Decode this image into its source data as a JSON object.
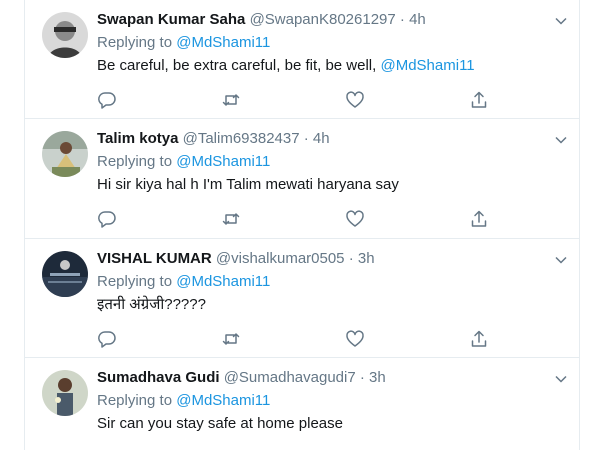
{
  "tweets": [
    {
      "name": "Swapan Kumar Saha",
      "handle": "@SwapanK80261297",
      "time": "4h",
      "replying_prefix": "Replying to",
      "replying_handle": "@MdShami11",
      "text_before": "Be careful, be extra careful, be fit, be well, ",
      "text_mention": "@MdShami11",
      "icons": [
        "reply-icon",
        "retweet-icon",
        "like-icon",
        "share-icon"
      ]
    },
    {
      "name": "Talim kotya",
      "handle": "@Talim69382437",
      "time": "4h",
      "replying_prefix": "Replying to",
      "replying_handle": "@MdShami11",
      "text": "Hi sir kiya hal h I'm Talim mewati haryana say",
      "icons": [
        "reply-icon",
        "retweet-icon",
        "like-icon",
        "share-icon"
      ]
    },
    {
      "name": "VISHAL KUMAR",
      "handle": "@vishalkumar0505",
      "time": "3h",
      "replying_prefix": "Replying to",
      "replying_handle": "@MdShami11",
      "text": "इतनी अंग्रेजी?????",
      "icons": [
        "reply-icon",
        "retweet-icon",
        "like-icon",
        "share-icon"
      ]
    },
    {
      "name": "Sumadhava Gudi",
      "handle": "@Sumadhavagudi7",
      "time": "3h",
      "replying_prefix": "Replying to",
      "replying_handle": "@MdShami11",
      "text": "Sir can you stay safe at home please"
    }
  ],
  "separator": "·",
  "colors": {
    "link": "#1b95e0",
    "muted": "#657786",
    "text": "#14171a",
    "border": "#e6ecf0"
  }
}
